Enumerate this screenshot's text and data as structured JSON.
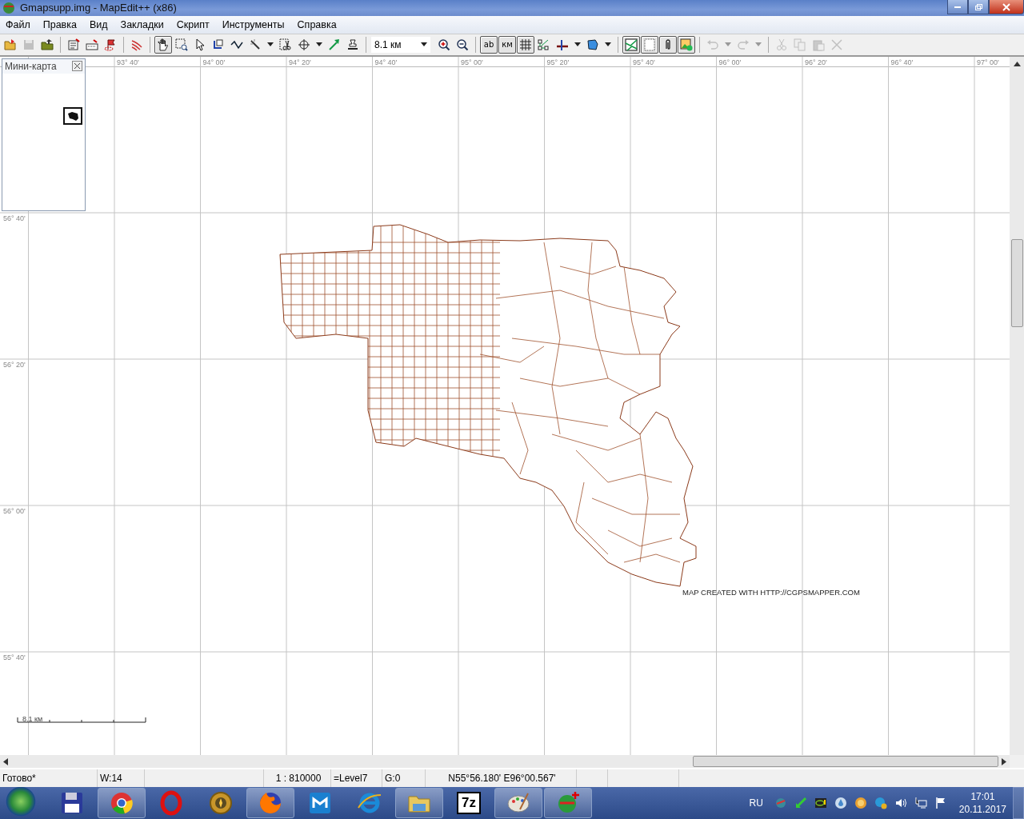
{
  "window": {
    "title": "Gmapsupp.img - MapEdit++ (x86)"
  },
  "menu": [
    "Файл",
    "Правка",
    "Вид",
    "Закладки",
    "Скрипт",
    "Инструменты",
    "Справка"
  ],
  "toolbar": [
    {
      "kind": "button",
      "pressed": false,
      "disabled": false,
      "dropdown": false
    },
    {
      "kind": "button",
      "pressed": false,
      "disabled": true,
      "dropdown": false
    },
    {
      "kind": "button",
      "pressed": false,
      "disabled": false,
      "dropdown": false
    },
    {
      "kind": "separator"
    },
    {
      "kind": "button",
      "pressed": false,
      "disabled": false,
      "dropdown": false
    },
    {
      "kind": "button",
      "pressed": false,
      "disabled": false,
      "dropdown": false
    },
    {
      "kind": "button",
      "pressed": false,
      "disabled": false,
      "dropdown": false
    },
    {
      "kind": "separator"
    },
    {
      "kind": "button",
      "pressed": false,
      "disabled": false,
      "dropdown": false
    },
    {
      "kind": "separator"
    },
    {
      "kind": "button",
      "pressed": true,
      "disabled": false,
      "dropdown": false
    },
    {
      "kind": "button",
      "pressed": false,
      "disabled": false,
      "dropdown": false
    },
    {
      "kind": "button",
      "pressed": false,
      "disabled": false,
      "dropdown": false
    },
    {
      "kind": "button",
      "pressed": false,
      "disabled": false,
      "dropdown": false
    },
    {
      "kind": "button",
      "pressed": false,
      "disabled": false,
      "dropdown": false
    },
    {
      "kind": "button",
      "pressed": false,
      "disabled": false,
      "dropdown": true
    },
    {
      "kind": "button",
      "pressed": false,
      "disabled": false,
      "dropdown": false
    },
    {
      "kind": "button",
      "pressed": false,
      "disabled": false,
      "dropdown": true
    },
    {
      "kind": "button",
      "pressed": false,
      "disabled": false,
      "dropdown": false
    },
    {
      "kind": "button",
      "pressed": false,
      "disabled": false,
      "dropdown": false
    },
    {
      "kind": "separator"
    },
    {
      "kind": "scale",
      "value": "8.1 км"
    },
    {
      "kind": "button",
      "pressed": false,
      "disabled": false,
      "dropdown": false
    },
    {
      "kind": "button",
      "pressed": false,
      "disabled": false,
      "dropdown": false
    },
    {
      "kind": "separator"
    },
    {
      "kind": "text",
      "label": "ab",
      "pressed": true
    },
    {
      "kind": "text",
      "label": "км",
      "pressed": true
    },
    {
      "kind": "button",
      "pressed": true,
      "disabled": false,
      "dropdown": false
    },
    {
      "kind": "button",
      "pressed": false,
      "disabled": false,
      "dropdown": false
    },
    {
      "kind": "button",
      "pressed": false,
      "disabled": false,
      "dropdown": true
    },
    {
      "kind": "button",
      "pressed": false,
      "disabled": false,
      "dropdown": true
    },
    {
      "kind": "separator"
    },
    {
      "kind": "button",
      "pressed": true,
      "disabled": false,
      "dropdown": false
    },
    {
      "kind": "button",
      "pressed": true,
      "disabled": false,
      "dropdown": false
    },
    {
      "kind": "button",
      "pressed": true,
      "disabled": false,
      "dropdown": false
    },
    {
      "kind": "button",
      "pressed": true,
      "disabled": false,
      "dropdown": false
    },
    {
      "kind": "separator"
    },
    {
      "kind": "button",
      "pressed": false,
      "disabled": true,
      "dropdown": true
    },
    {
      "kind": "button",
      "pressed": false,
      "disabled": true,
      "dropdown": true
    },
    {
      "kind": "separator"
    },
    {
      "kind": "button",
      "pressed": false,
      "disabled": true,
      "dropdown": false
    },
    {
      "kind": "button",
      "pressed": false,
      "disabled": true,
      "dropdown": false
    },
    {
      "kind": "button",
      "pressed": false,
      "disabled": true,
      "dropdown": false
    },
    {
      "kind": "button",
      "pressed": false,
      "disabled": true,
      "dropdown": false
    }
  ],
  "minimap": {
    "title": "Мини-карта"
  },
  "map": {
    "longitudes": [
      "93° 40'",
      "94° 00'",
      "94° 20'",
      "94° 40'",
      "95° 00'",
      "95° 20'",
      "95° 40'",
      "96° 00'",
      "96° 20'",
      "96° 40'",
      "97° 00'"
    ],
    "latitudes": [
      "56° 40'",
      "56° 20'",
      "56° 00'",
      "55° 40'"
    ],
    "credit": "MAP CREATED WITH HTTP://CGPSMAPPER.COM",
    "scale_label": "8.1 км"
  },
  "status_bar": {
    "state": "Готово*",
    "width": "W:14",
    "scale": "1 : 810000",
    "level": "=Level7",
    "group": "G:0",
    "position": "N55°56.180' E96°00.567'"
  },
  "taskbar": {
    "apps": [
      {
        "running": false
      },
      {
        "running": true
      },
      {
        "running": false
      },
      {
        "running": false
      },
      {
        "running": true
      },
      {
        "running": false
      },
      {
        "running": false
      },
      {
        "running": true
      },
      {
        "running": false,
        "label": "7z"
      },
      {
        "running": true
      },
      {
        "running": true
      }
    ],
    "language": "RU",
    "time": "17:01",
    "date": "20.11.2017"
  }
}
